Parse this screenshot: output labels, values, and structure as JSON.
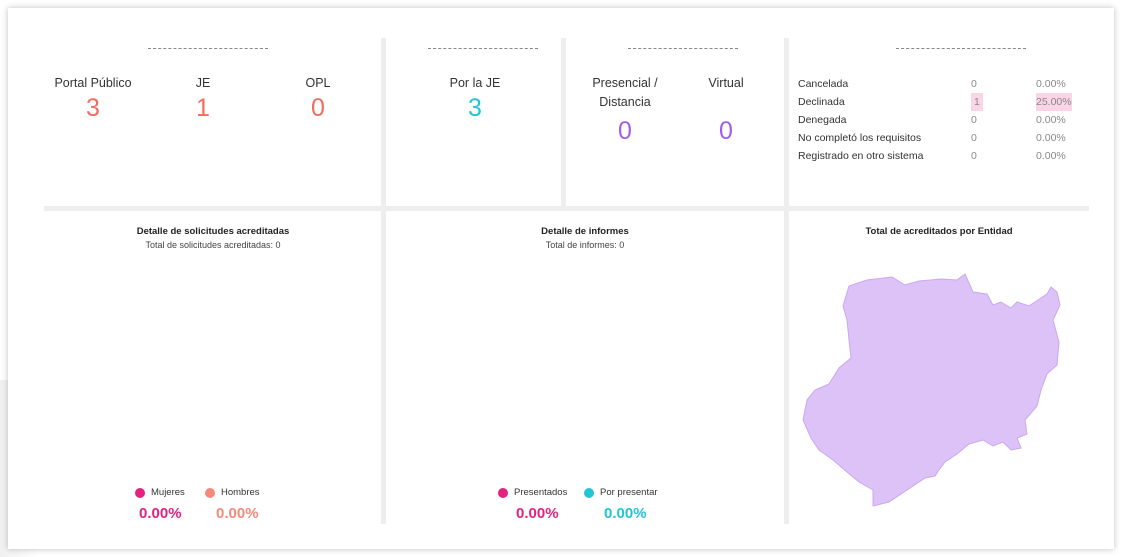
{
  "top": {
    "panel1": {
      "stats": [
        {
          "label": "Portal Público",
          "value": "3"
        },
        {
          "label": "JE",
          "value": "1"
        },
        {
          "label": "OPL",
          "value": "0"
        }
      ]
    },
    "panel2": {
      "stats": [
        {
          "label": "Por la JE",
          "value": "3"
        }
      ]
    },
    "panel3": {
      "stats": [
        {
          "label": "Presencial / Distancia",
          "value": "0"
        },
        {
          "label": "Virtual",
          "value": "0"
        }
      ]
    },
    "panel4": {
      "rows": [
        {
          "label": "Cancelada",
          "count": "0",
          "percent": "0.00%"
        },
        {
          "label": "Declinada",
          "count": "1",
          "percent": "25.00%"
        },
        {
          "label": "Denegada",
          "count": "0",
          "percent": "0.00%"
        },
        {
          "label": "No completó los requisitos",
          "count": "0",
          "percent": "0.00%"
        },
        {
          "label": "Registrado en otro sistema",
          "count": "0",
          "percent": "0.00%"
        }
      ]
    }
  },
  "bottom": {
    "acreditadas": {
      "title": "Detalle de solicitudes acreditadas",
      "subtitle": "Total de solicitudes acreditadas: 0",
      "legend": [
        {
          "label": "Mujeres",
          "value": "0.00%",
          "color": "#e3227f"
        },
        {
          "label": "Hombres",
          "value": "0.00%",
          "color": "#f58a7c"
        }
      ]
    },
    "informes": {
      "title": "Detalle de informes",
      "subtitle": "Total de informes: 0",
      "legend": [
        {
          "label": "Presentados",
          "value": "0.00%",
          "color": "#e3227f"
        },
        {
          "label": "Por presentar",
          "value": "0.00%",
          "color": "#22c4d6"
        }
      ]
    },
    "entidad": {
      "title": "Total de acreditados por Entidad",
      "map_color": "#dcc2f7"
    }
  }
}
